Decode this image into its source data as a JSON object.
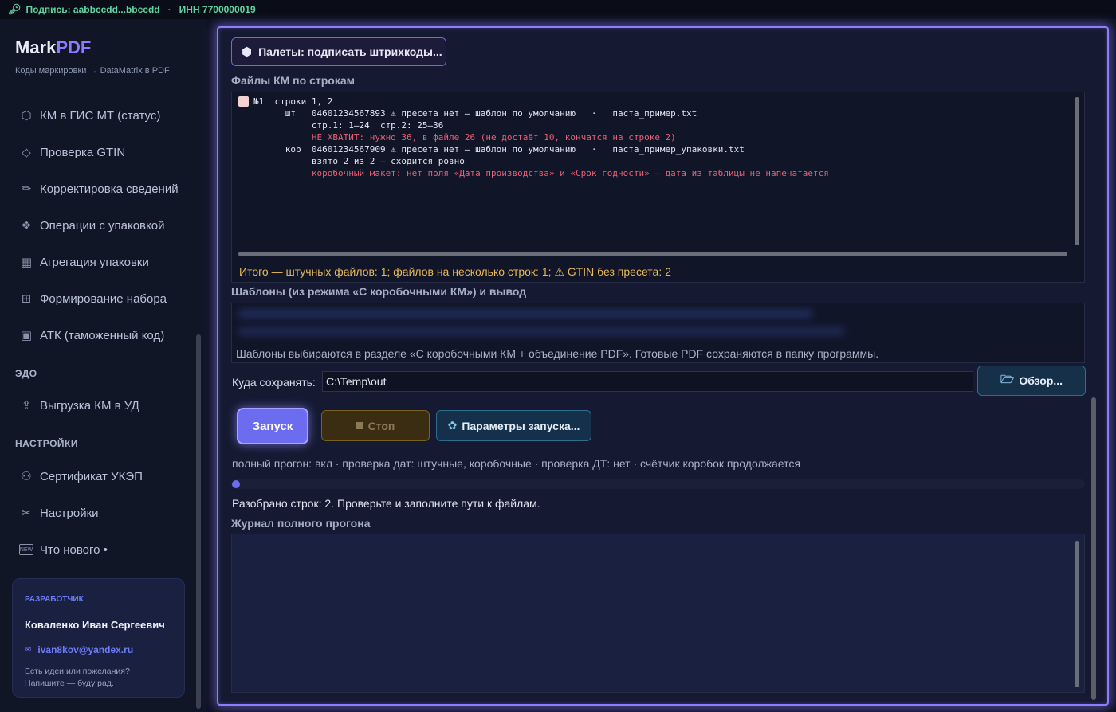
{
  "topbar": {
    "signature": "Подпись: aabbccdd...bbccdd",
    "inn": "ИНН 7700000019"
  },
  "brand": {
    "name_part1": "Mark",
    "name_part2": "PDF",
    "subtitle": "Коды маркировки → DataMatrix в PDF"
  },
  "sidebar": {
    "items": [
      {
        "label": "КМ в ГИС МТ (статус)",
        "icon": "tags-icon"
      },
      {
        "label": "Проверка GTIN",
        "icon": "tag-icon"
      },
      {
        "label": "Корректировка сведений",
        "icon": "pencil-icon"
      },
      {
        "label": "Операции с упаковкой",
        "icon": "box-ops-icon"
      },
      {
        "label": "Агрегация упаковки",
        "icon": "bricks-icon"
      },
      {
        "label": "Формирование набора",
        "icon": "gift-icon"
      },
      {
        "label": "АТК (таможенный код)",
        "icon": "chart-icon"
      }
    ],
    "section_edo": "ЭДО",
    "edo_items": [
      {
        "label": "Выгрузка КМ в УД",
        "icon": "upload-icon"
      }
    ],
    "section_settings": "НАСТРОЙКИ",
    "settings_items": [
      {
        "label": "Сертификат УКЭП",
        "icon": "certificate-icon"
      },
      {
        "label": "Настройки",
        "icon": "tools-icon"
      },
      {
        "label": "Что нового  •",
        "icon": "new-icon"
      }
    ],
    "developer": {
      "title": "РАЗРАБОТЧИК",
      "name": "Коваленко Иван Сергеевич",
      "email": "ivan8kov@yandex.ru",
      "note1": "Есть идеи или пожелания?",
      "note2": "Напишите — буду рад."
    }
  },
  "main": {
    "pallet_button": "Палеты: подписать штрихкоды...",
    "files_label": "Файлы КМ по строкам",
    "files": {
      "line1": "№1  строки 1, 2",
      "line2": "      шт   04601234567893 ⚠ пресета нет — шаблон по умолчанию   ·   паста_пример.txt",
      "line3": "           стр.1: 1–24  стр.2: 25–36",
      "line4": "           НЕ ХВАТИТ: нужно 36, в файле 26 (не достаёт 10, кончатся на строке 2)",
      "line5": "      кор  04601234567909 ⚠ пресета нет — шаблон по умолчанию   ·   паста_пример_упаковки.txt",
      "line6": "           взято 2 из 2 — сходится ровно",
      "line7": "           коробочный макет: нет поля «Дата производства» и «Срок годности» — дата из таблицы не напечатается"
    },
    "summary": "Итого — штучных файлов: 1; файлов на несколько строк: 1; ⚠ GTIN без пресета: 2",
    "templates_label": "Шаблоны (из режима «С коробочными КМ») и вывод",
    "templates_note": "Шаблоны выбираются в разделе «С коробочными КМ + объединение PDF». Готовые PDF сохраняются в папку программы.",
    "save_label": "Куда сохранять:",
    "save_value": "C:\\Temp\\out",
    "browse_button": "Обзор...",
    "run_button": "Запуск",
    "stop_button": "Стоп",
    "params_button": "Параметры запуска...",
    "status_line": "полный прогон: вкл · проверка дат: штучные, коробочные · проверка ДТ: нет · счётчик коробок продолжается",
    "progress": 0.0,
    "parsed_text": "Разобрано строк: 2. Проверьте и заполните пути к файлам.",
    "log_label": "Журнал полного прогона",
    "log_content": ""
  },
  "colors": {
    "accent": "#8d7cff",
    "warning": "#e7b85b",
    "error": "#e95f75",
    "success": "#5fd3a3"
  }
}
